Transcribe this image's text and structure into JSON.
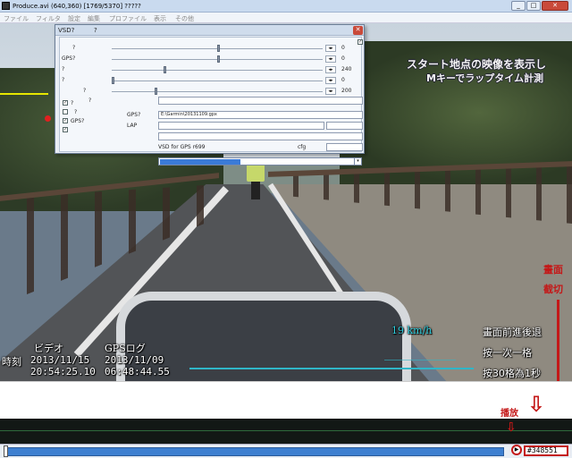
{
  "window": {
    "title": "Produce.avi (640,360) [1769/5370] ?????"
  },
  "menu": [
    "ファイル",
    "フィルタ",
    "設定",
    "編集",
    "プロファイル",
    "表示",
    "その他"
  ],
  "dialog": {
    "title": "VSD?",
    "title_extra": "?",
    "sliders": [
      {
        "label": "?",
        "value": "0",
        "level": 0.5
      },
      {
        "label": "GPS?",
        "value": "0",
        "level": 0.5
      },
      {
        "label": "?",
        "value": "240",
        "level": 0.25
      },
      {
        "label": "?",
        "value": "0",
        "level": 0.0
      },
      {
        "label": "?",
        "value": "200",
        "level": 0.2
      }
    ],
    "checks": [
      {
        "label": "?",
        "checked": true
      },
      {
        "label": "?",
        "checked": false
      },
      {
        "label": "GPS?",
        "checked": true
      },
      {
        "label": "",
        "checked": true
      }
    ],
    "gps_label": "GPS?",
    "gps_file": "E:\\Garmin\\20131109.gpx",
    "lap_label": "LAP",
    "dropdown_selected": "",
    "version": "VSD for GPS r699",
    "cfg_label": "cfg"
  },
  "overlay": {
    "instruction_line1": "スタート地点の映像を表示し",
    "instruction_line2": "Mキーでラップタイム計測",
    "speed": "19 km/h",
    "video_label": "ビデオ",
    "gps_log_label": "GPSログ",
    "time_label": "時刻",
    "video_date": "2013/11/15",
    "gps_date": "2013/11/09",
    "video_time": "20:54:25.10",
    "gps_time": "06:48:44.55"
  },
  "annotations": {
    "screen_switch_line1": "畫面",
    "screen_switch_line2": "截切",
    "help_line1": "畫面前進後退",
    "help_line2": "按一次一格",
    "help_line3": "按30格為1秒",
    "play_label": "播放"
  },
  "playback": {
    "play_icon": "play-icon",
    "frame_number": "#348551",
    "progress": 0.0
  },
  "colors": {
    "annotation_red": "#c41818",
    "seek_blue": "#3d7fd0",
    "speed_cyan": "#2fb6c8"
  }
}
